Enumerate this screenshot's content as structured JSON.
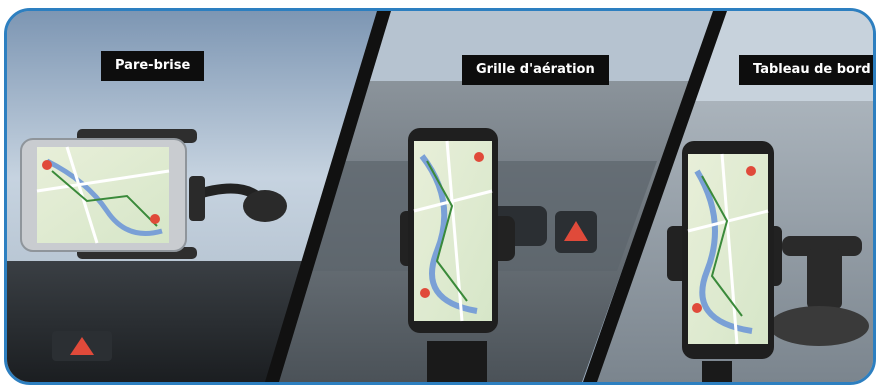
{
  "labels": {
    "windshield": "Pare-brise",
    "vent": "Grille d'aération",
    "dashboard": "Tableau de bord"
  },
  "colors": {
    "frame_border": "#2d7fc0",
    "label_bg": "#0d0d0d",
    "label_text": "#ffffff",
    "divider": "#111111"
  }
}
